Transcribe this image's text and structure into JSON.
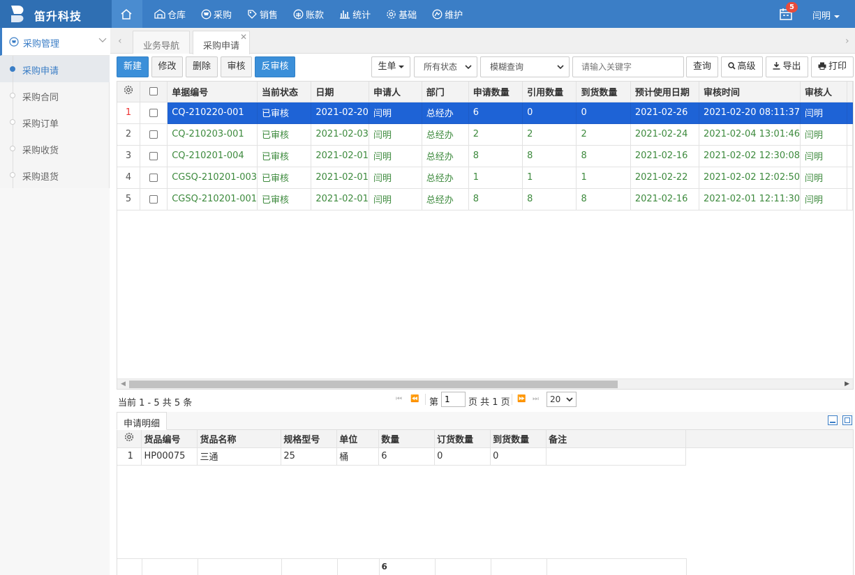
{
  "app": {
    "name": "笛升科技"
  },
  "nav": {
    "items": [
      "仓库",
      "采购",
      "销售",
      "账款",
      "统计",
      "基础",
      "维护"
    ]
  },
  "notifications": {
    "count": "5"
  },
  "user": {
    "name": "闫明"
  },
  "sidebar": {
    "section": "采购管理",
    "items": [
      "采购申请",
      "采购合同",
      "采购订单",
      "采购收货",
      "采购退货"
    ]
  },
  "tabs": {
    "items": [
      "业务导航",
      "采购申请"
    ]
  },
  "toolbar": {
    "new": "新建",
    "edit": "修改",
    "delete": "删除",
    "approve": "审核",
    "unapprove": "反审核",
    "generate": "生单",
    "status_filter": "所有状态",
    "query_mode": "模糊查询",
    "search_placeholder": "请输入关键字",
    "query": "查询",
    "advanced": "高级",
    "export": "导出",
    "print": "打印"
  },
  "grid": {
    "columns": [
      "单据编号",
      "当前状态",
      "日期",
      "申请人",
      "部门",
      "申请数量",
      "引用数量",
      "到货数量",
      "预计使用日期",
      "审核时间",
      "审核人"
    ],
    "rows": [
      [
        "CQ-210220-001",
        "已审核",
        "2021-02-20",
        "闫明",
        "总经办",
        "6",
        "0",
        "0",
        "2021-02-26",
        "2021-02-20 08:11:37",
        "闫明"
      ],
      [
        "CQ-210203-001",
        "已审核",
        "2021-02-03",
        "闫明",
        "总经办",
        "2",
        "2",
        "2",
        "2021-02-24",
        "2021-02-04 13:01:46",
        "闫明"
      ],
      [
        "CQ-210201-004",
        "已审核",
        "2021-02-01",
        "闫明",
        "总经办",
        "8",
        "8",
        "8",
        "2021-02-16",
        "2021-02-02 12:30:08",
        "闫明"
      ],
      [
        "CGSQ-210201-003",
        "已审核",
        "2021-02-01",
        "闫明",
        "总经办",
        "1",
        "1",
        "1",
        "2021-02-22",
        "2021-02-02 12:02:50",
        "闫明"
      ],
      [
        "CGSQ-210201-001",
        "已审核",
        "2021-02-01",
        "闫明",
        "总经办",
        "8",
        "8",
        "8",
        "2021-02-16",
        "2021-02-01 12:11:30",
        "闫明"
      ]
    ]
  },
  "pager": {
    "summary": "当前 1 - 5 共 5 条",
    "page_label": "第",
    "page_value": "1",
    "total_label": "页 共 1 页",
    "page_size": "20"
  },
  "detail": {
    "tab": "申请明细",
    "columns": [
      "货品编号",
      "货品名称",
      "规格型号",
      "单位",
      "数量",
      "订货数量",
      "到货数量",
      "备注"
    ],
    "rows": [
      [
        "HP00075",
        "三通",
        "25",
        "桶",
        "6",
        "0",
        "0",
        ""
      ]
    ],
    "total_qty": "6"
  },
  "colors": {
    "topbar": "#3b7ec6",
    "selected_row": "#1e63d6",
    "approved_text": "#3d8a3d",
    "primary_button": "#3b8fd9"
  }
}
